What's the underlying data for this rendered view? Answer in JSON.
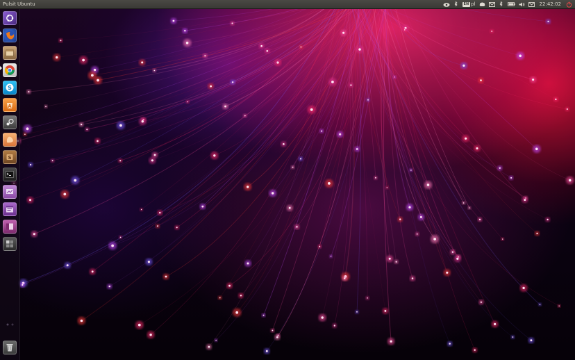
{
  "panel": {
    "window_title": "Pulsit Ubuntu",
    "keyboard_layout": "pl",
    "clock": "22:42:02",
    "indicators": [
      "cloud-icon",
      "bluetooth-icon",
      "keyboard-icon",
      "dropbox-icon",
      "mail-icon",
      "bluetooth-icon",
      "battery-icon",
      "volume-icon",
      "power-icon"
    ]
  },
  "launcher": {
    "items": [
      {
        "name": "dash-home",
        "icon": "ubuntu-logo-icon",
        "color": "#6b3fa0"
      },
      {
        "name": "firefox",
        "icon": "firefox-icon",
        "color": "#e8700f"
      },
      {
        "name": "files",
        "icon": "files-icon",
        "color": "#9a7a55"
      },
      {
        "name": "chrome",
        "icon": "chrome-icon",
        "color": "#4caf50"
      },
      {
        "name": "skype",
        "icon": "skype-icon",
        "color": "#00aff0"
      },
      {
        "name": "software-center",
        "icon": "software-center-icon",
        "color": "#e8862b"
      },
      {
        "name": "steam",
        "icon": "steam-icon",
        "color": "#5a5a5a"
      },
      {
        "name": "app-orange",
        "icon": "orange-app-icon",
        "color": "#f2994a"
      },
      {
        "name": "app-brown",
        "icon": "brown-app-icon",
        "color": "#8b5a2b"
      },
      {
        "name": "terminal",
        "icon": "terminal-icon",
        "color": "#2d2d2d"
      },
      {
        "name": "app-purple",
        "icon": "purple-app-icon",
        "color": "#9b59b6"
      },
      {
        "name": "app-violet",
        "icon": "violet-app-icon",
        "color": "#8e44ad"
      },
      {
        "name": "app-magenta",
        "icon": "magenta-app-icon",
        "color": "#a2418f"
      },
      {
        "name": "workspace",
        "icon": "workspace-icon",
        "color": "#3a3a3a"
      }
    ],
    "trash_icon": "trash-icon"
  },
  "colors": {
    "panel_bg": "#3a3935",
    "panel_text": "#dfdbd2",
    "accent_red": "#ff1e3c",
    "accent_violet": "#6a2bd8"
  }
}
